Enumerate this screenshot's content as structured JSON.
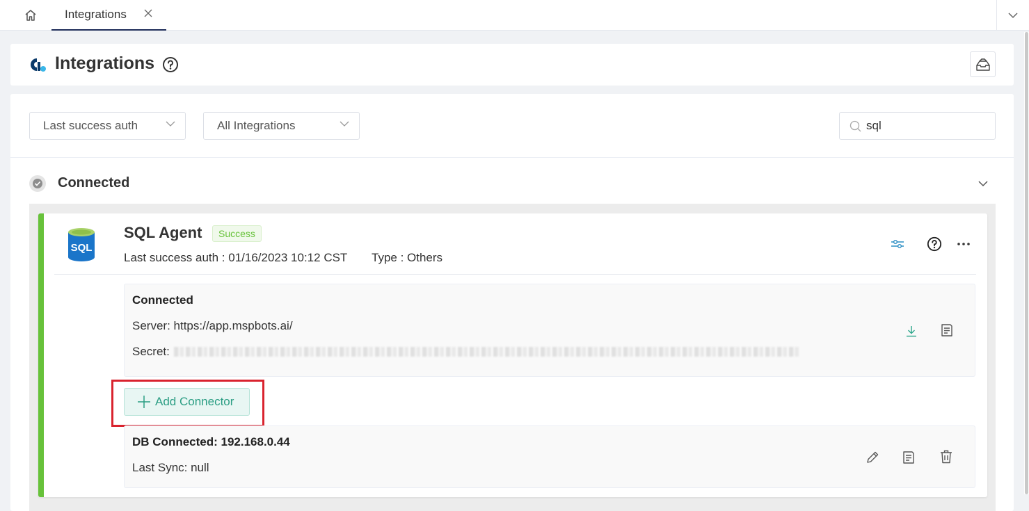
{
  "tabs": {
    "home_icon": "home-icon",
    "active_tab": "Integrations",
    "close_icon": "close-icon",
    "dropdown_icon": "chevron-down-icon"
  },
  "header": {
    "title": "Integrations",
    "help_icon": "help-circle-icon",
    "action_icon": "inbox-tray-icon"
  },
  "filters": {
    "sort_select": "Last success auth",
    "integration_select": "All Integrations",
    "search_value": "sql",
    "search_icon": "search-icon"
  },
  "section": {
    "title": "Connected",
    "check_icon": "check-circle-icon",
    "toggle_icon": "chevron-down-icon"
  },
  "integration": {
    "name": "SQL Agent",
    "status": "Success",
    "last_auth": "Last success auth : 01/16/2023 10:12 CST",
    "type": "Type : Others",
    "logo_text": "SQL",
    "connection": {
      "title": "Connected",
      "server": "Server: https://app.mspbots.ai/",
      "secret_label": "Secret:"
    },
    "add_connector": "Add Connector",
    "db": {
      "title": "DB Connected: 192.168.0.44",
      "last_sync": "Last Sync: null"
    }
  },
  "colors": {
    "accent_green": "#67c23a",
    "teal": "#2a9d83",
    "highlight_red": "#d9232e",
    "logo_blue": "#1a75c9"
  }
}
